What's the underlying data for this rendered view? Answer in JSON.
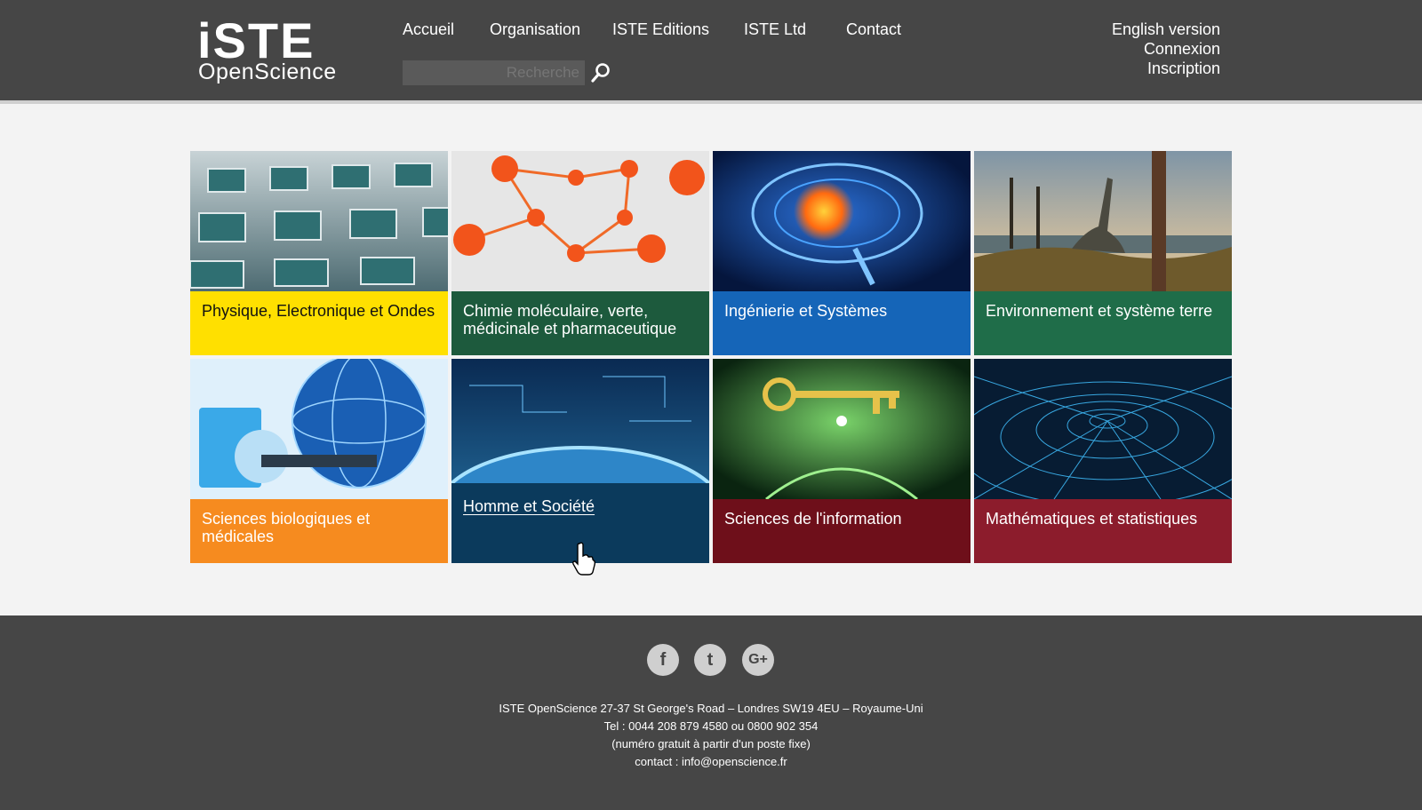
{
  "header": {
    "logo_text": "iSTE",
    "logo_sub": "OpenScience",
    "nav": [
      "Accueil",
      "Organisation",
      "ISTE Editions",
      "ISTE Ltd",
      "Contact"
    ],
    "search_placeholder": "Recherche",
    "account": [
      "English version",
      "Connexion",
      "Inscription"
    ]
  },
  "tiles": [
    {
      "label": "Physique, Electronique et Ondes",
      "color": "#ffe000",
      "icon": "microchip-grid-image"
    },
    {
      "label": "Chimie moléculaire, verte, médicinale et pharmaceutique",
      "color": "#1d5a3d",
      "icon": "molecule-image"
    },
    {
      "label": "Ingénierie et Systèmes",
      "color": "#1565b8",
      "icon": "brain-circuit-image"
    },
    {
      "label": "Environnement et système terre",
      "color": "#1f6d49",
      "icon": "dinosaur-landscape-image"
    },
    {
      "label": "Sciences biologiques et médicales",
      "color": "#f68b1f",
      "icon": "scanner-globe-image"
    },
    {
      "label": "Homme et Société",
      "color": "#0b3a5c",
      "icon": "earth-network-image"
    },
    {
      "label": "Sciences de l'information",
      "color": "#6e0f1a",
      "icon": "digital-key-image"
    },
    {
      "label": "Mathématiques et statistiques",
      "color": "#8c1c2c",
      "icon": "mesh-funnel-image"
    }
  ],
  "footer": {
    "social": [
      "f",
      "t",
      "G+"
    ],
    "address": "ISTE OpenScience 27-37 St George's Road – Londres SW19 4EU – Royaume-Uni",
    "tel": "Tel : 0044 208 879 4580 ou 0800 902 354",
    "tel_note": "(numéro gratuit à partir d'un poste fixe)",
    "contact": "contact : info@openscience.fr"
  }
}
